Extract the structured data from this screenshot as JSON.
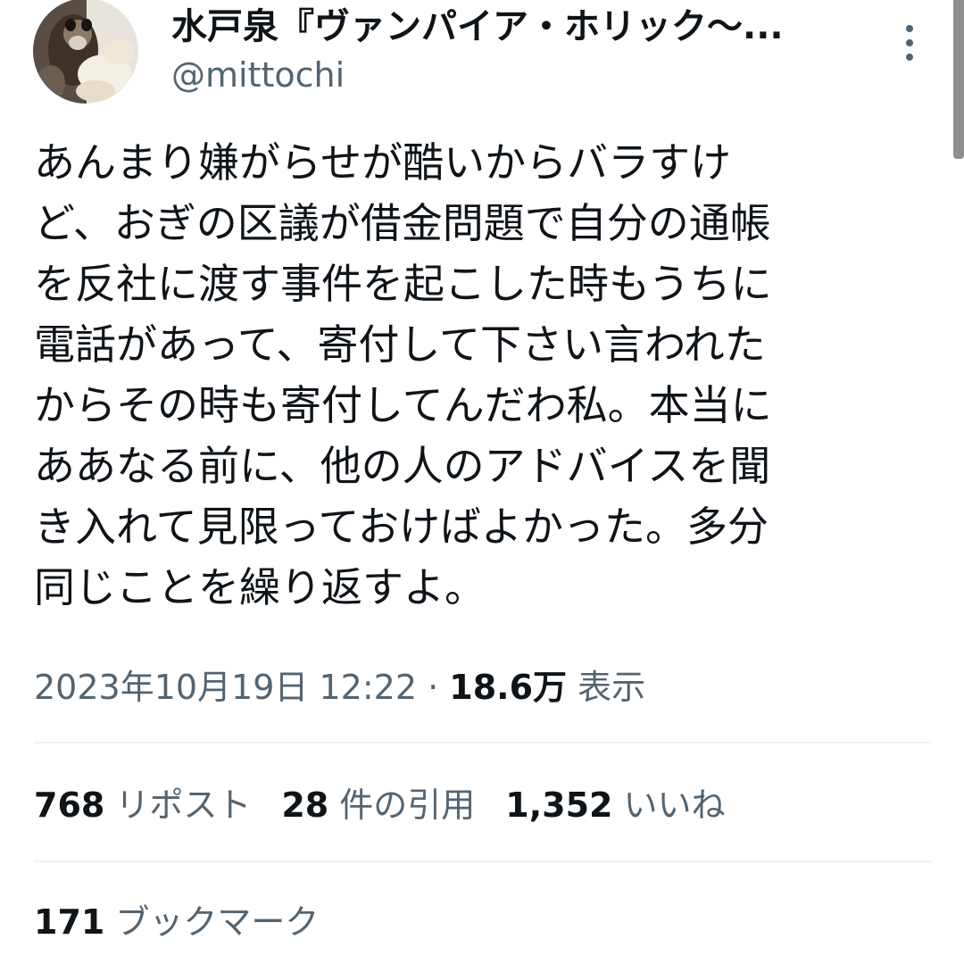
{
  "author": {
    "display_name": "水戸泉『ヴァンパイア・ホリック〜...",
    "handle": "@mittochi",
    "avatar_icon": "sugar-glider-avatar"
  },
  "more_icon": "more-vertical-icon",
  "tweet": {
    "lines": [
      "あんまり嫌がらせが酷いからバラすけ",
      "ど、おぎの区議が借金問題で自分の通帳",
      "を反社に渡す事件を起こした時もうちに",
      "電話があって、寄付して下さい言われた",
      "からその時も寄付してんだわ私。本当に",
      "ああなる前に、他の人のアドバイスを聞",
      "き入れて見限っておけばよかった。多分",
      "同じことを繰り返すよ。"
    ]
  },
  "meta": {
    "timestamp": "2023年10月19日 12:22",
    "separator": " · ",
    "views_count": "18.6万",
    "views_label": "表示"
  },
  "stats": {
    "reposts": {
      "count": "768",
      "label": "リポスト"
    },
    "quotes": {
      "count": "28",
      "label": "件の引用"
    },
    "likes": {
      "count": "1,352",
      "label": "いいね"
    },
    "bookmarks": {
      "count": "171",
      "label": "ブックマーク"
    }
  },
  "colors": {
    "text_primary": "#0f1419",
    "text_secondary": "#536471",
    "divider": "#eff3f4"
  }
}
